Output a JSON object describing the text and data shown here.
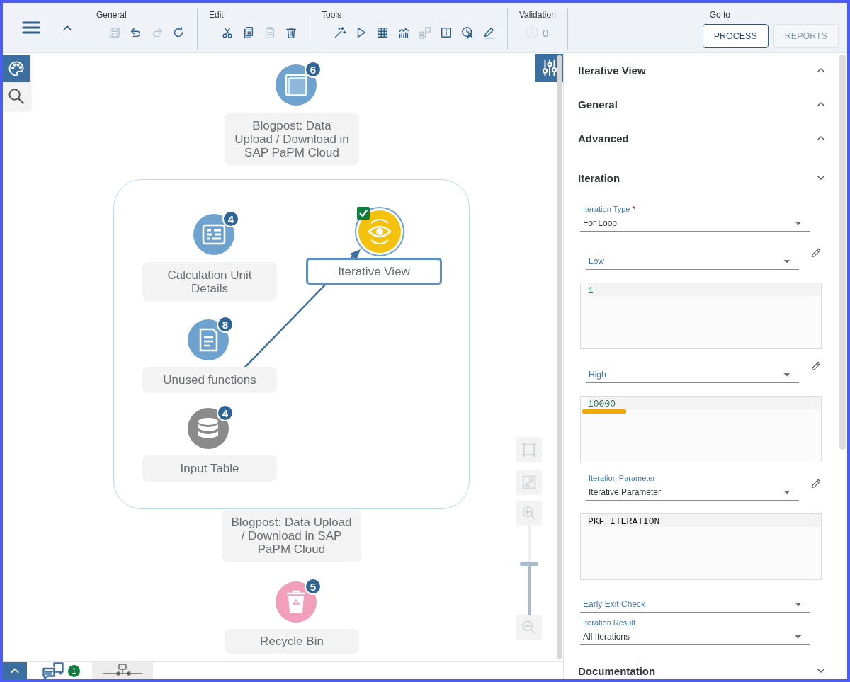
{
  "toolbar": {
    "groups": [
      {
        "title": "General",
        "tools": [
          {
            "disabled": true
          },
          {
            "disabled": false
          },
          {
            "disabled": true
          },
          {
            "disabled": false
          }
        ]
      },
      {
        "title": "Edit",
        "tools": [
          {
            "disabled": false
          },
          {
            "disabled": false
          },
          {
            "disabled": true
          },
          {
            "disabled": false
          }
        ]
      },
      {
        "title": "Tools",
        "tools": [
          {
            "disabled": false
          },
          {
            "disabled": false
          },
          {
            "disabled": false
          },
          {
            "disabled": false
          },
          {
            "disabled": true
          },
          {
            "disabled": false
          },
          {
            "disabled": false
          },
          {
            "disabled": false
          }
        ]
      }
    ],
    "validation": {
      "title": "Validation",
      "count": "0",
      "disabled": true
    },
    "goto": {
      "title": "Go to",
      "buttons": [
        {
          "label": "PROCESS",
          "disabled": false
        },
        {
          "label": "REPORTS",
          "disabled": true
        }
      ]
    }
  },
  "side_tools": [
    {
      "selected": true
    },
    {
      "selected": false
    }
  ],
  "canvas": {
    "nodes": [
      {
        "kind": "model",
        "label": "Blogpost: Data Upload / Download in SAP PaPM Cloud",
        "badge": "6",
        "selected": false
      },
      {
        "kind": "calc",
        "label": "Calculation Unit Details",
        "badge": "4",
        "selected": false
      },
      {
        "kind": "view",
        "label": "Iterative View",
        "selected": true,
        "checked": true
      },
      {
        "kind": "functions",
        "label": "Unused functions",
        "badge": "8",
        "selected": false
      },
      {
        "kind": "table",
        "label": "Input Table",
        "badge": "4",
        "selected": false
      },
      {
        "kind": "bin",
        "label": "Recycle Bin",
        "badge": "5",
        "selected": false
      }
    ],
    "group": {
      "label": "Blogpost: Data Upload / Download in SAP PaPM Cloud"
    },
    "zoom": {
      "level": 0.59
    }
  },
  "bottom_bar": {
    "message_count": "1",
    "tabs": [
      {
        "selected": false
      },
      {
        "selected": true
      }
    ]
  },
  "panel": {
    "sections": [
      {
        "title": "Iterative View",
        "expanded": false
      },
      {
        "title": "General",
        "expanded": false
      },
      {
        "title": "Advanced",
        "expanded": false
      },
      {
        "title": "Iteration",
        "expanded": true,
        "fields": [
          {
            "kind": "select",
            "label": "Iteration Type",
            "required_mark": "*",
            "value": "For Loop",
            "editable": false
          },
          {
            "kind": "select",
            "placeholder": "Low",
            "editable": true
          },
          {
            "kind": "code",
            "text": "1",
            "color": "#1b7a54",
            "highlighted": false
          },
          {
            "kind": "select",
            "placeholder": "High",
            "editable": true
          },
          {
            "kind": "code",
            "text": "10000",
            "color": "#1b7a54",
            "highlighted": true
          },
          {
            "kind": "select",
            "label": "Iteration Parameter",
            "value": "Iterative Parameter",
            "editable": true
          },
          {
            "kind": "code",
            "text": "PKF_ITERATION",
            "color": "#111111",
            "highlighted": false
          },
          {
            "kind": "select",
            "placeholder": "Early Exit Check",
            "editable": false
          },
          {
            "kind": "select",
            "label": "Iteration Result",
            "value": "All Iterations",
            "editable": false
          }
        ]
      },
      {
        "title": "Documentation",
        "expanded": true
      }
    ]
  }
}
